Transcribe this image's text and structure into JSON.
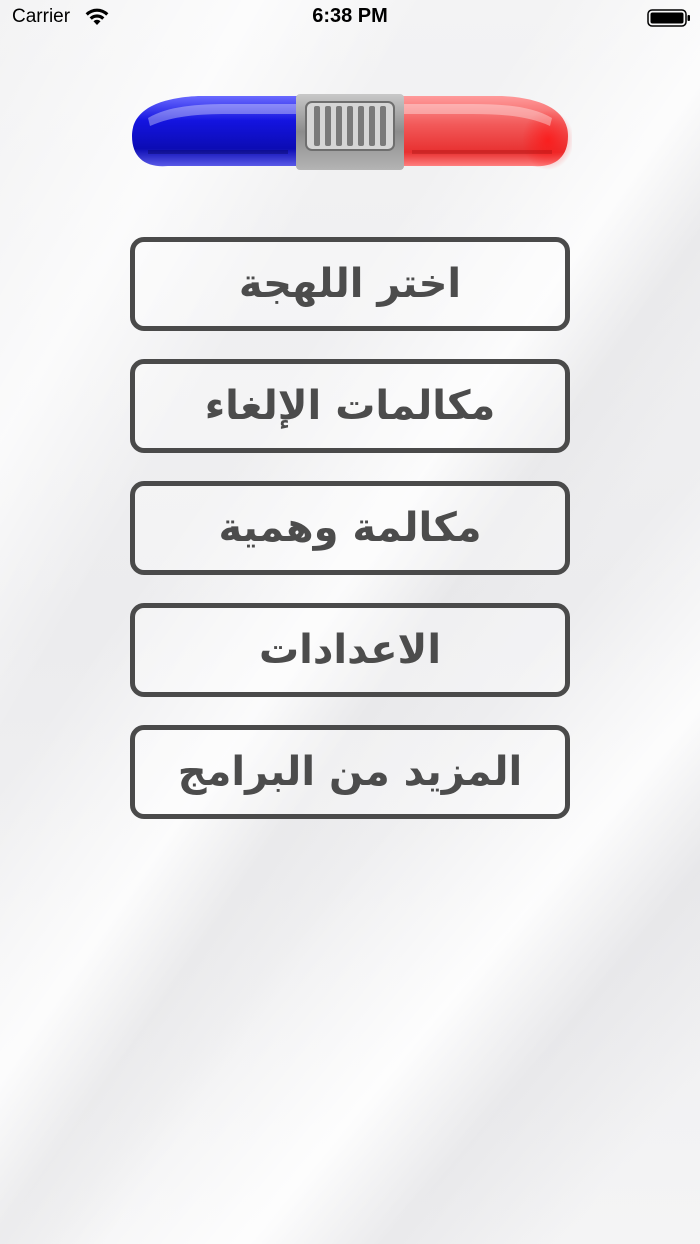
{
  "status_bar": {
    "carrier": "Carrier",
    "time": "6:38 PM"
  },
  "header": {
    "logo_icon": "police-siren-light-bar",
    "colors": {
      "left_light": "#1a1ad8",
      "center": "#9a9a9a",
      "right_light": "#f04040"
    }
  },
  "menu": {
    "items": [
      {
        "label": "اختر اللهجة"
      },
      {
        "label": "مكالمات الإلغاء"
      },
      {
        "label": "مكالمة وهمية"
      },
      {
        "label": "الاعدادات"
      },
      {
        "label": "المزيد من البرامج"
      }
    ],
    "border_color": "#4a4a4a",
    "text_color": "#4c4c4c"
  }
}
